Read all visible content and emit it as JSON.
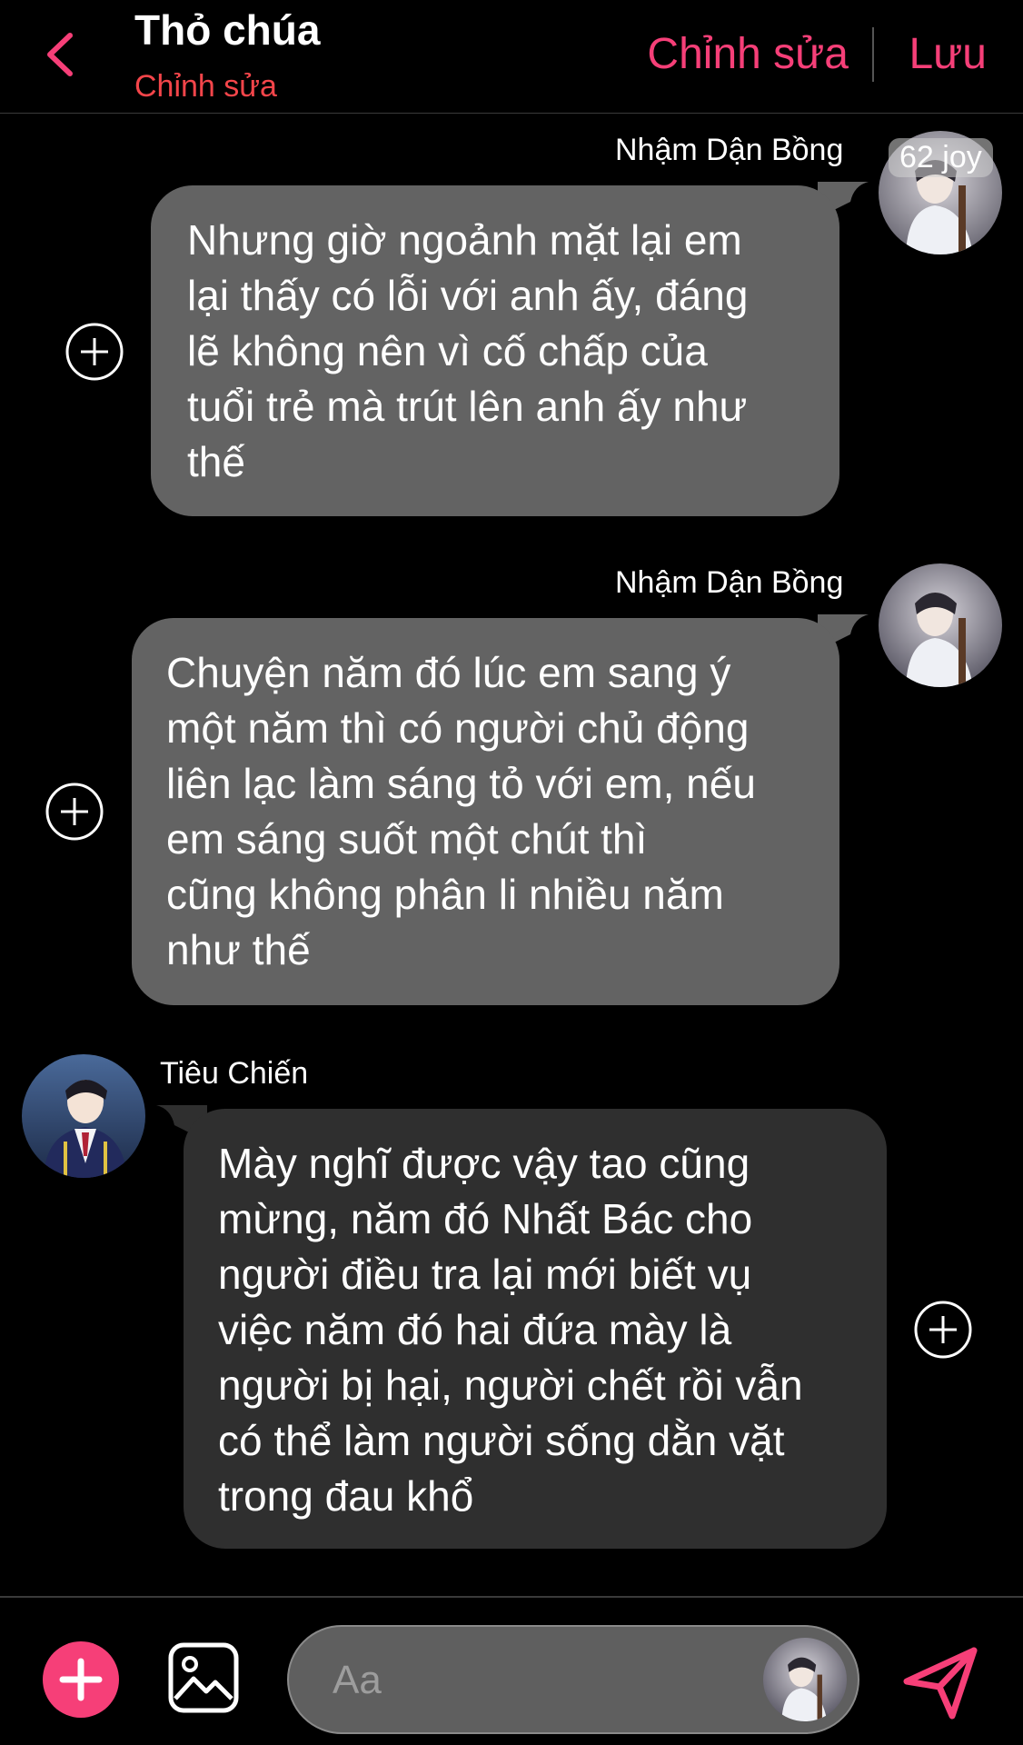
{
  "header": {
    "title": "Thỏ chúa",
    "subtitle": "Chỉnh sửa",
    "edit_label": "Chỉnh sửa",
    "save_label": "Lưu"
  },
  "messages": [
    {
      "sender": "Nhậm Dận Bồng",
      "side": "right",
      "badge": "62 joy",
      "lines": [
        "Nhưng giờ ngoảnh mặt lại em",
        "lại thấy có lỗi với anh ấy, đáng",
        "lẽ không nên vì cố chấp của",
        "tuổi trẻ mà trút lên anh ấy như",
        "thế"
      ]
    },
    {
      "sender": "Nhậm Dận Bồng",
      "side": "right",
      "lines": [
        "Chuyện năm đó lúc em sang ý",
        "một năm thì có người chủ động",
        "liên lạc làm sáng tỏ với em, nếu",
        "em sáng suốt một chút thì",
        "cũng không phân li nhiều năm",
        "như thế"
      ]
    },
    {
      "sender": "Tiêu Chiến",
      "side": "left",
      "lines": [
        "Mày nghĩ được vậy tao cũng",
        "mừng, năm đó Nhất Bác cho",
        "người điều tra lại mới biết vụ",
        "việc năm đó hai đứa mày là",
        "người bị hại, người chết rồi vẫn",
        "có thể làm người sống dằn vặt",
        "trong đau khổ"
      ]
    }
  ],
  "composer": {
    "placeholder": "Aa"
  },
  "colors": {
    "accent": "#f63f78",
    "subtitle": "#f4454a",
    "bubble_gray": "#636363",
    "bubble_dark": "#2f2f2f"
  }
}
